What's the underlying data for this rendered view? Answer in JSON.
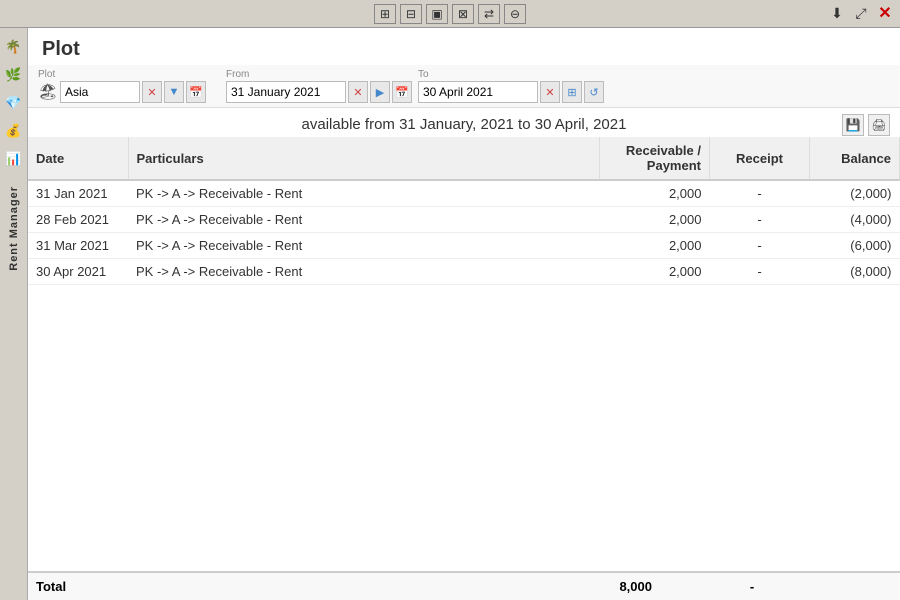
{
  "toolbar": {
    "icons": [
      "⊞",
      "⊟",
      "▣",
      "⊠",
      "⇄",
      "⊖"
    ],
    "top_right": [
      "⬇",
      "⤢",
      "✕"
    ]
  },
  "side": {
    "label": "Rent Manager",
    "icons": [
      "🌴",
      "🌿",
      "💎",
      "💰",
      "📊"
    ]
  },
  "page": {
    "title": "Plot"
  },
  "filter": {
    "plot_label": "Plot",
    "plot_value": "Asia",
    "from_label": "From",
    "from_value": "31 January 2021",
    "to_label": "To",
    "to_value": "30 April 2021"
  },
  "range_header": {
    "text": "available from 31 January, 2021 to 30 April, 2021"
  },
  "table": {
    "columns": [
      {
        "key": "date",
        "label": "Date",
        "align": "left"
      },
      {
        "key": "particulars",
        "label": "Particulars",
        "align": "left"
      },
      {
        "key": "receivable",
        "label": "Receivable /\nPayment",
        "align": "right"
      },
      {
        "key": "receipt",
        "label": "Receipt",
        "align": "center"
      },
      {
        "key": "balance",
        "label": "Balance",
        "align": "right"
      }
    ],
    "rows": [
      {
        "date": "31 Jan 2021",
        "particulars": "PK -> A -> Receivable - Rent",
        "receivable": "2,000",
        "receipt": "-",
        "balance": "(2,000)"
      },
      {
        "date": "28 Feb 2021",
        "particulars": "PK -> A -> Receivable - Rent",
        "receivable": "2,000",
        "receipt": "-",
        "balance": "(4,000)"
      },
      {
        "date": "31 Mar 2021",
        "particulars": "PK -> A -> Receivable - Rent",
        "receivable": "2,000",
        "receipt": "-",
        "balance": "(6,000)"
      },
      {
        "date": "30 Apr 2021",
        "particulars": "PK -> A -> Receivable - Rent",
        "receivable": "2,000",
        "receipt": "-",
        "balance": "(8,000)"
      }
    ]
  },
  "footer": {
    "label": "Total",
    "receivable_total": "8,000",
    "receipt_total": "-"
  }
}
